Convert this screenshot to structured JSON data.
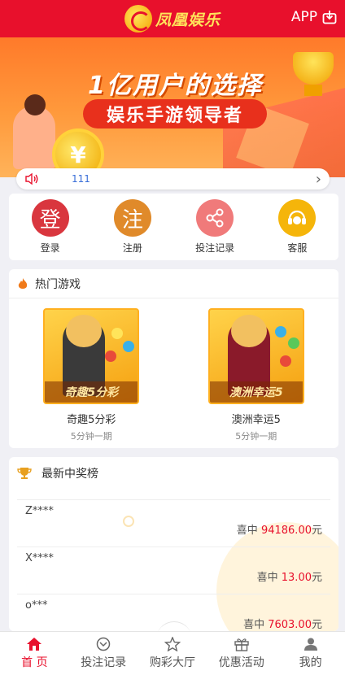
{
  "header": {
    "logo_text": "凤凰娱乐",
    "app_label": "APP"
  },
  "banner": {
    "title": "1亿用户的选择",
    "subtitle": "娱乐手游领导者",
    "coin_symbol": "¥"
  },
  "notice": {
    "text": "111"
  },
  "quick_menu": [
    {
      "glyph": "登",
      "label": "登录",
      "color": "#d9363e"
    },
    {
      "glyph": "注",
      "label": "注册",
      "color": "#e08a2a"
    },
    {
      "glyph": "share-icon",
      "label": "投注记录",
      "color": "#f07a7a"
    },
    {
      "glyph": "headset-icon",
      "label": "客服",
      "color": "#f5b50a"
    }
  ],
  "hot_games": {
    "title": "热门游戏",
    "items": [
      {
        "name": "奇趣5分彩",
        "banner_text": "奇趣5分彩",
        "period": "5分钟一期",
        "dress_color": "#3a3a3a"
      },
      {
        "name": "澳洲幸运5",
        "banner_text": "澳洲幸运5",
        "period": "5分钟一期",
        "dress_color": "#8a1a2a"
      }
    ]
  },
  "winners": {
    "title": "最新中奖榜",
    "win_prefix": "喜中",
    "currency": "元",
    "rows": [
      {
        "user": "Z****",
        "amount": "94186.00"
      },
      {
        "user": "X****",
        "amount": "13.00"
      },
      {
        "user": "o***",
        "amount": "7603.00"
      }
    ]
  },
  "tabbar": [
    {
      "label": "首 页",
      "icon": "home-icon",
      "active": true
    },
    {
      "label": "投注记录",
      "icon": "record-icon",
      "active": false
    },
    {
      "label": "购彩大厅",
      "icon": "star-icon",
      "active": false
    },
    {
      "label": "优惠活动",
      "icon": "gift-icon",
      "active": false
    },
    {
      "label": "我的",
      "icon": "user-icon",
      "active": false
    }
  ],
  "colors": {
    "brand_red": "#e8102c",
    "accent_gold": "#ffe45a",
    "notice_blue": "#3a6fd8"
  }
}
